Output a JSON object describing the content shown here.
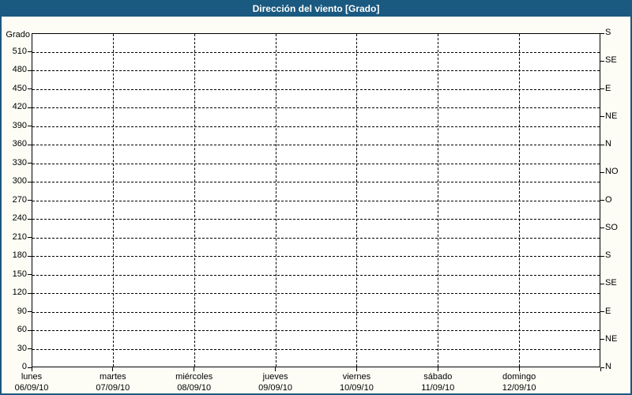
{
  "window": {
    "title": "Dirección del viento [Grado]",
    "colors": {
      "title_bar_bg": "#1A5980",
      "window_border": "#1A5980",
      "window_bg": "#FDFDF6",
      "plot_bg": "#FFFFFF",
      "grid": "#000000",
      "text": "#000000",
      "title_text": "#FFFFFF"
    }
  },
  "chart_data": {
    "type": "line",
    "title": "Dirección del viento [Grado]",
    "grid": "dashed",
    "legend_position": "none",
    "series": [],
    "y_axis_left": {
      "label": "Grado",
      "min": 0,
      "max": 540,
      "tick_step": 30,
      "tick_labels": [
        "510",
        "480",
        "450",
        "420",
        "390",
        "360",
        "330",
        "300",
        "270",
        "240",
        "210",
        "180",
        "150",
        "120",
        "90",
        "60",
        "30",
        "0"
      ]
    },
    "y_axis_right": {
      "tick_step": 45,
      "ticks": [
        {
          "deg": 540,
          "label": "S"
        },
        {
          "deg": 495,
          "label": "SE"
        },
        {
          "deg": 450,
          "label": "E"
        },
        {
          "deg": 405,
          "label": "NE"
        },
        {
          "deg": 360,
          "label": "N"
        },
        {
          "deg": 315,
          "label": "NO"
        },
        {
          "deg": 270,
          "label": "O"
        },
        {
          "deg": 225,
          "label": "SO"
        },
        {
          "deg": 180,
          "label": "S"
        },
        {
          "deg": 135,
          "label": "SE"
        },
        {
          "deg": 90,
          "label": "E"
        },
        {
          "deg": 45,
          "label": "NE"
        },
        {
          "deg": 0,
          "label": "N"
        }
      ]
    },
    "x_axis": {
      "days": [
        {
          "name": "lunes",
          "date": "06/09/10"
        },
        {
          "name": "martes",
          "date": "07/09/10"
        },
        {
          "name": "miércoles",
          "date": "08/09/10"
        },
        {
          "name": "jueves",
          "date": "09/09/10"
        },
        {
          "name": "viernes",
          "date": "10/09/10"
        },
        {
          "name": "sábado",
          "date": "11/09/10"
        },
        {
          "name": "domingo",
          "date": "12/09/10"
        }
      ]
    }
  }
}
